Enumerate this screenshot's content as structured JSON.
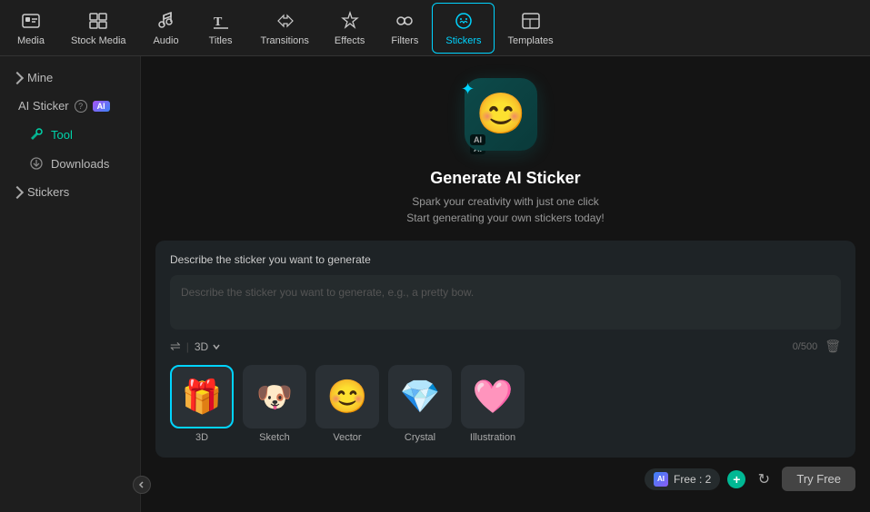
{
  "nav": {
    "items": [
      {
        "id": "media",
        "label": "Media",
        "icon": "media"
      },
      {
        "id": "stock-media",
        "label": "Stock Media",
        "icon": "stock-media"
      },
      {
        "id": "audio",
        "label": "Audio",
        "icon": "audio"
      },
      {
        "id": "titles",
        "label": "Titles",
        "icon": "titles"
      },
      {
        "id": "transitions",
        "label": "Transitions",
        "icon": "transitions"
      },
      {
        "id": "effects",
        "label": "Effects",
        "icon": "effects"
      },
      {
        "id": "filters",
        "label": "Filters",
        "icon": "filters"
      },
      {
        "id": "stickers",
        "label": "Stickers",
        "icon": "stickers",
        "active": true
      },
      {
        "id": "templates",
        "label": "Templates",
        "icon": "templates"
      }
    ]
  },
  "sidebar": {
    "mine_label": "Mine",
    "ai_sticker_label": "AI Sticker",
    "tool_label": "Tool",
    "downloads_label": "Downloads",
    "stickers_label": "Stickers"
  },
  "hero": {
    "title": "Generate AI Sticker",
    "subtitle_line1": "Spark your creativity with just one click",
    "subtitle_line2": "Start generating your own stickers today!"
  },
  "panel": {
    "label": "Describe the sticker you want to generate",
    "placeholder": "Describe the sticker you want to generate, e.g., a pretty bow.",
    "style_label": "3D",
    "char_count": "0/500"
  },
  "sticker_styles": [
    {
      "id": "3d",
      "label": "3D",
      "emoji": "🎁",
      "selected": true
    },
    {
      "id": "sketch",
      "label": "Sketch",
      "emoji": "🐶"
    },
    {
      "id": "vector",
      "label": "Vector",
      "emoji": "😊"
    },
    {
      "id": "crystal",
      "label": "Crystal",
      "emoji": "💎"
    },
    {
      "id": "illustration",
      "label": "Illustration",
      "emoji": "🩷"
    }
  ],
  "bottom_bar": {
    "ai_label": "AI",
    "free_label": "Free : 2",
    "try_free_label": "Try Free"
  }
}
